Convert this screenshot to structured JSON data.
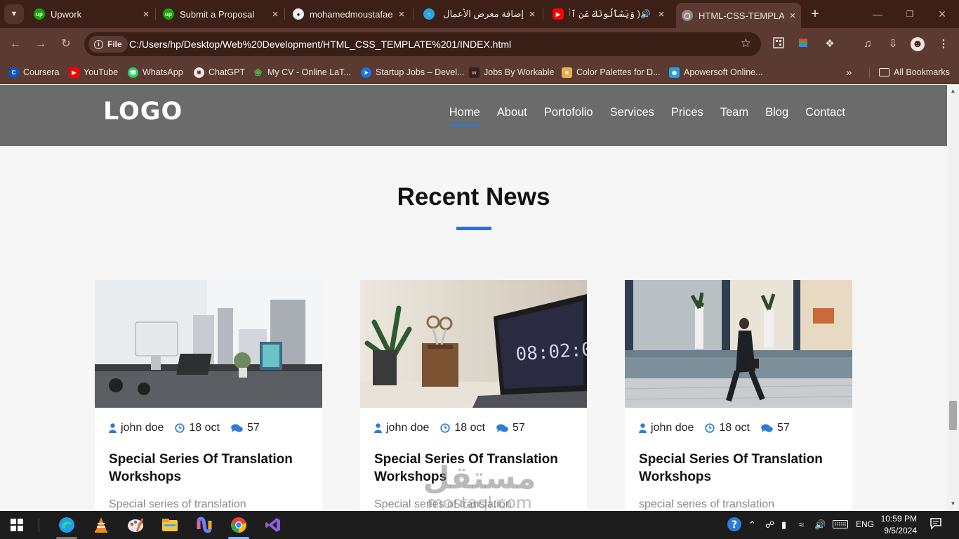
{
  "browser": {
    "tabs": [
      {
        "title": "Upwork",
        "icon": "upwork-icon"
      },
      {
        "title": "Submit a Proposal",
        "icon": "upwork-icon"
      },
      {
        "title": "mohamedmoustafaeg",
        "icon": "github-icon"
      },
      {
        "title": "إضافة معرض الأعمال",
        "icon": "mostaql-icon"
      },
      {
        "title": "( وَيَسْأَلُونَكَ عَنِ ٱلْجِ",
        "icon": "youtube-icon"
      },
      {
        "title": "HTML-CSS-TEMPLATE",
        "icon": "globe-icon"
      }
    ],
    "active_tab_index": 5,
    "address": {
      "chip": "File",
      "url": "C:/Users/hp/Desktop/Web%20Development/HTML_CSS_TEMPLATE%201/INDEX.html"
    },
    "bookmarks": [
      {
        "label": "Coursera",
        "icon": "coursera-icon"
      },
      {
        "label": "YouTube",
        "icon": "youtube-icon"
      },
      {
        "label": "WhatsApp",
        "icon": "whatsapp-icon"
      },
      {
        "label": "ChatGPT",
        "icon": "chatgpt-icon"
      },
      {
        "label": "My CV - Online LaT...",
        "icon": "overleaf-icon"
      },
      {
        "label": "Startup Jobs – Devel...",
        "icon": "startup-jobs-icon"
      },
      {
        "label": "Jobs By Workable",
        "icon": "workable-icon"
      },
      {
        "label": "Color Palettes for D...",
        "icon": "color-palette-icon"
      },
      {
        "label": "Apowersoft Online...",
        "icon": "apowersoft-icon"
      }
    ],
    "all_bookmarks_label": "All Bookmarks",
    "more_bookmarks": "»"
  },
  "site": {
    "logo": "LOGO",
    "nav": [
      "Home",
      "About",
      "Portofolio",
      "Services",
      "Prices",
      "Team",
      "Blog",
      "Contact"
    ],
    "active_nav": "Home",
    "accent_color": "#2f6fdb",
    "section": {
      "title": "Recent News",
      "cards": [
        {
          "image": "office-desk-photo",
          "author": "john doe",
          "date": "18 oct",
          "comments": "57",
          "title": "Special Series Of Translation Workshops",
          "excerpt": "Special series of translation"
        },
        {
          "image": "laptop-clock-photo",
          "author": "john doe",
          "date": "18 oct",
          "comments": "57",
          "title": "Special Series Of Translation Workshops",
          "excerpt": "Special series of translation"
        },
        {
          "image": "street-walker-photo",
          "author": "john doe",
          "date": "18 oct",
          "comments": "57",
          "title": "Special Series Of Translation Workshops",
          "excerpt": "special series of translation"
        }
      ]
    }
  },
  "watermark": {
    "arabic": "مستقل",
    "latin": "mostaql.com"
  },
  "taskbar": {
    "apps": [
      "windows-start-icon",
      "edge-icon",
      "vlc-icon",
      "paint-icon",
      "file-explorer-icon",
      "copilot-icon",
      "chrome-icon",
      "visual-studio-icon"
    ],
    "language": "ENG",
    "time": "10:59 PM",
    "date": "9/5/2024"
  }
}
